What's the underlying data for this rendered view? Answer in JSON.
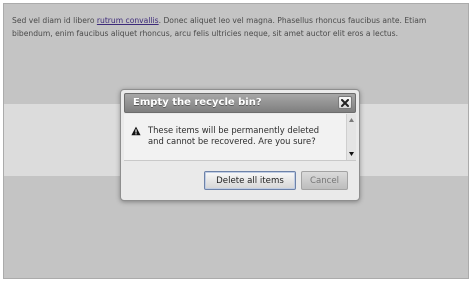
{
  "page": {
    "paragraph_before": "Sed vel diam id libero ",
    "link": "rutrum convallis",
    "paragraph_after": ". Donec aliquet leo vel magna. Phasellus rhoncus faucibus ante. Etiam bibendum, enim faucibus aliquet rhoncus, arcu felis ultricies neque, sit amet auctor elit eros a lectus."
  },
  "dialog": {
    "title": "Empty the recycle bin?",
    "close_icon": "close-icon",
    "warning_icon": "warning-icon",
    "message": "These items will be permanently deleted and cannot be recovered. Are you sure?",
    "buttons": {
      "delete": "Delete all items",
      "cancel": "Cancel"
    }
  }
}
